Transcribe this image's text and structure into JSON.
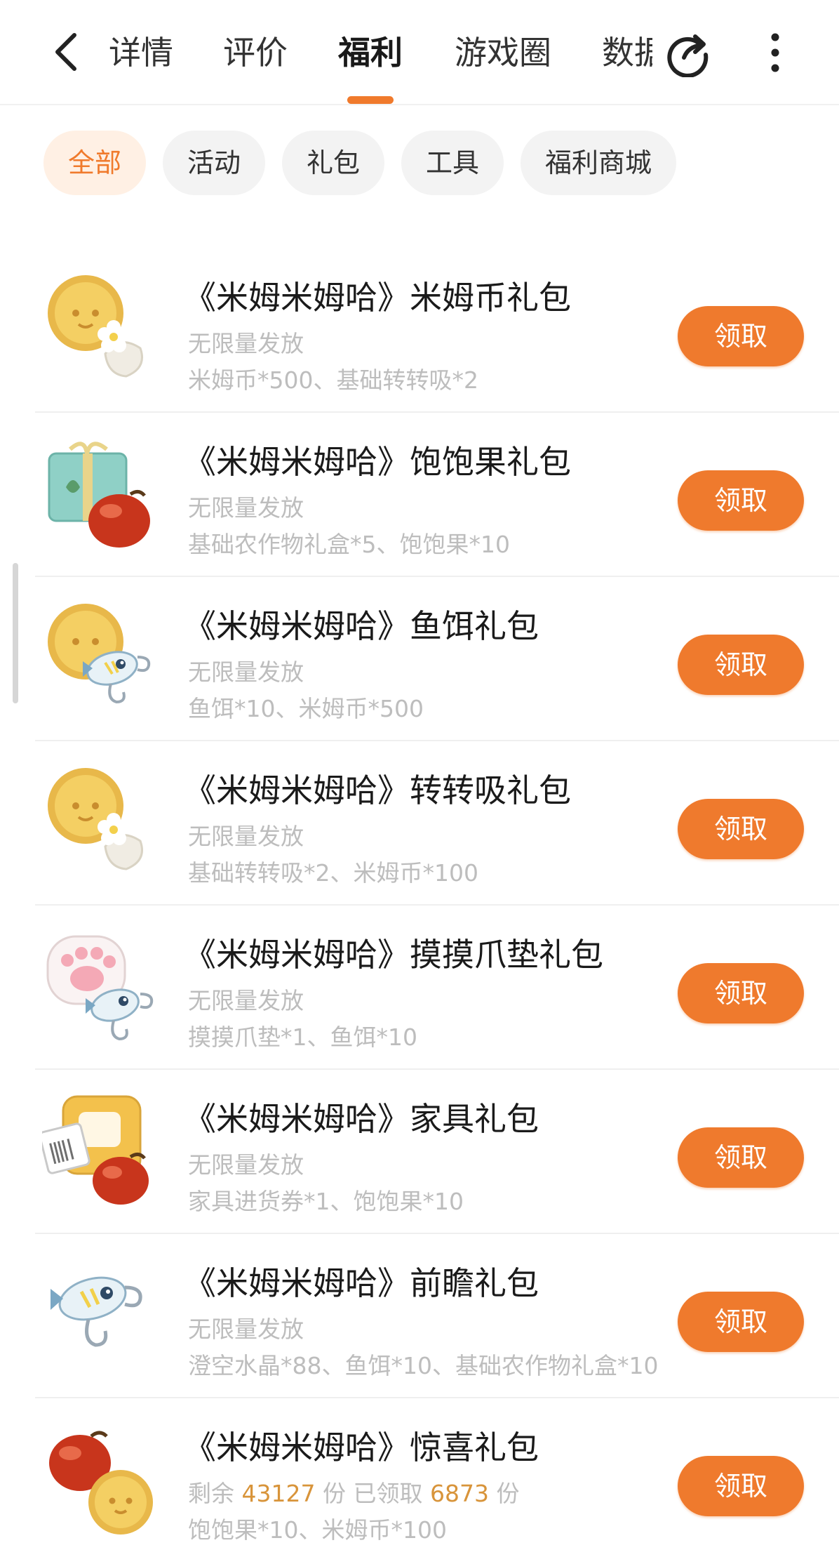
{
  "nav": {
    "tabs": [
      {
        "label": "详情"
      },
      {
        "label": "评价"
      },
      {
        "label": "福利"
      },
      {
        "label": "游戏圈"
      },
      {
        "label": "数据"
      }
    ],
    "active_tab": "福利"
  },
  "filters": [
    {
      "label": "全部"
    },
    {
      "label": "活动"
    },
    {
      "label": "礼包"
    },
    {
      "label": "工具"
    },
    {
      "label": "福利商城"
    }
  ],
  "colors": {
    "accent": "#ef7a2d",
    "muted_text": "#bdbdbd",
    "highlight_number": "#d8943a"
  },
  "gifts": [
    {
      "title": "《米姆米姆哈》米姆币礼包",
      "availability": "无限量发放",
      "contents": "米姆币*500、基础转转吸*2",
      "button": "领取",
      "icon": "coin-flower-icon"
    },
    {
      "title": "《米姆米姆哈》饱饱果礼包",
      "availability": "无限量发放",
      "contents": "基础农作物礼盒*5、饱饱果*10",
      "button": "领取",
      "icon": "giftbox-fruit-icon"
    },
    {
      "title": "《米姆米姆哈》鱼饵礼包",
      "availability": "无限量发放",
      "contents": "鱼饵*10、米姆币*500",
      "button": "领取",
      "icon": "coin-lure-icon"
    },
    {
      "title": "《米姆米姆哈》转转吸礼包",
      "availability": "无限量发放",
      "contents": "基础转转吸*2、米姆币*100",
      "button": "领取",
      "icon": "coin-flower-icon"
    },
    {
      "title": "《米姆米姆哈》摸摸爪垫礼包",
      "availability": "无限量发放",
      "contents": "摸摸爪垫*1、鱼饵*10",
      "button": "领取",
      "icon": "pawpad-lure-icon"
    },
    {
      "title": "《米姆米姆哈》家具礼包",
      "availability": "无限量发放",
      "contents": "家具进货券*1、饱饱果*10",
      "button": "领取",
      "icon": "ticket-fruit-icon"
    },
    {
      "title": "《米姆米姆哈》前瞻礼包",
      "availability": "无限量发放",
      "contents": "澄空水晶*88、鱼饵*10、基础农作物礼盒*10",
      "button": "领取",
      "icon": "lure-icon"
    },
    {
      "title": "《米姆米姆哈》惊喜礼包",
      "remaining_label": "剩余",
      "remaining": "43127",
      "unit1": "份",
      "claimed_label": "已领取",
      "claimed": "6873",
      "unit2": "份",
      "contents": "饱饱果*10、米姆币*100",
      "button": "领取",
      "icon": "fruit-coin-icon"
    }
  ]
}
